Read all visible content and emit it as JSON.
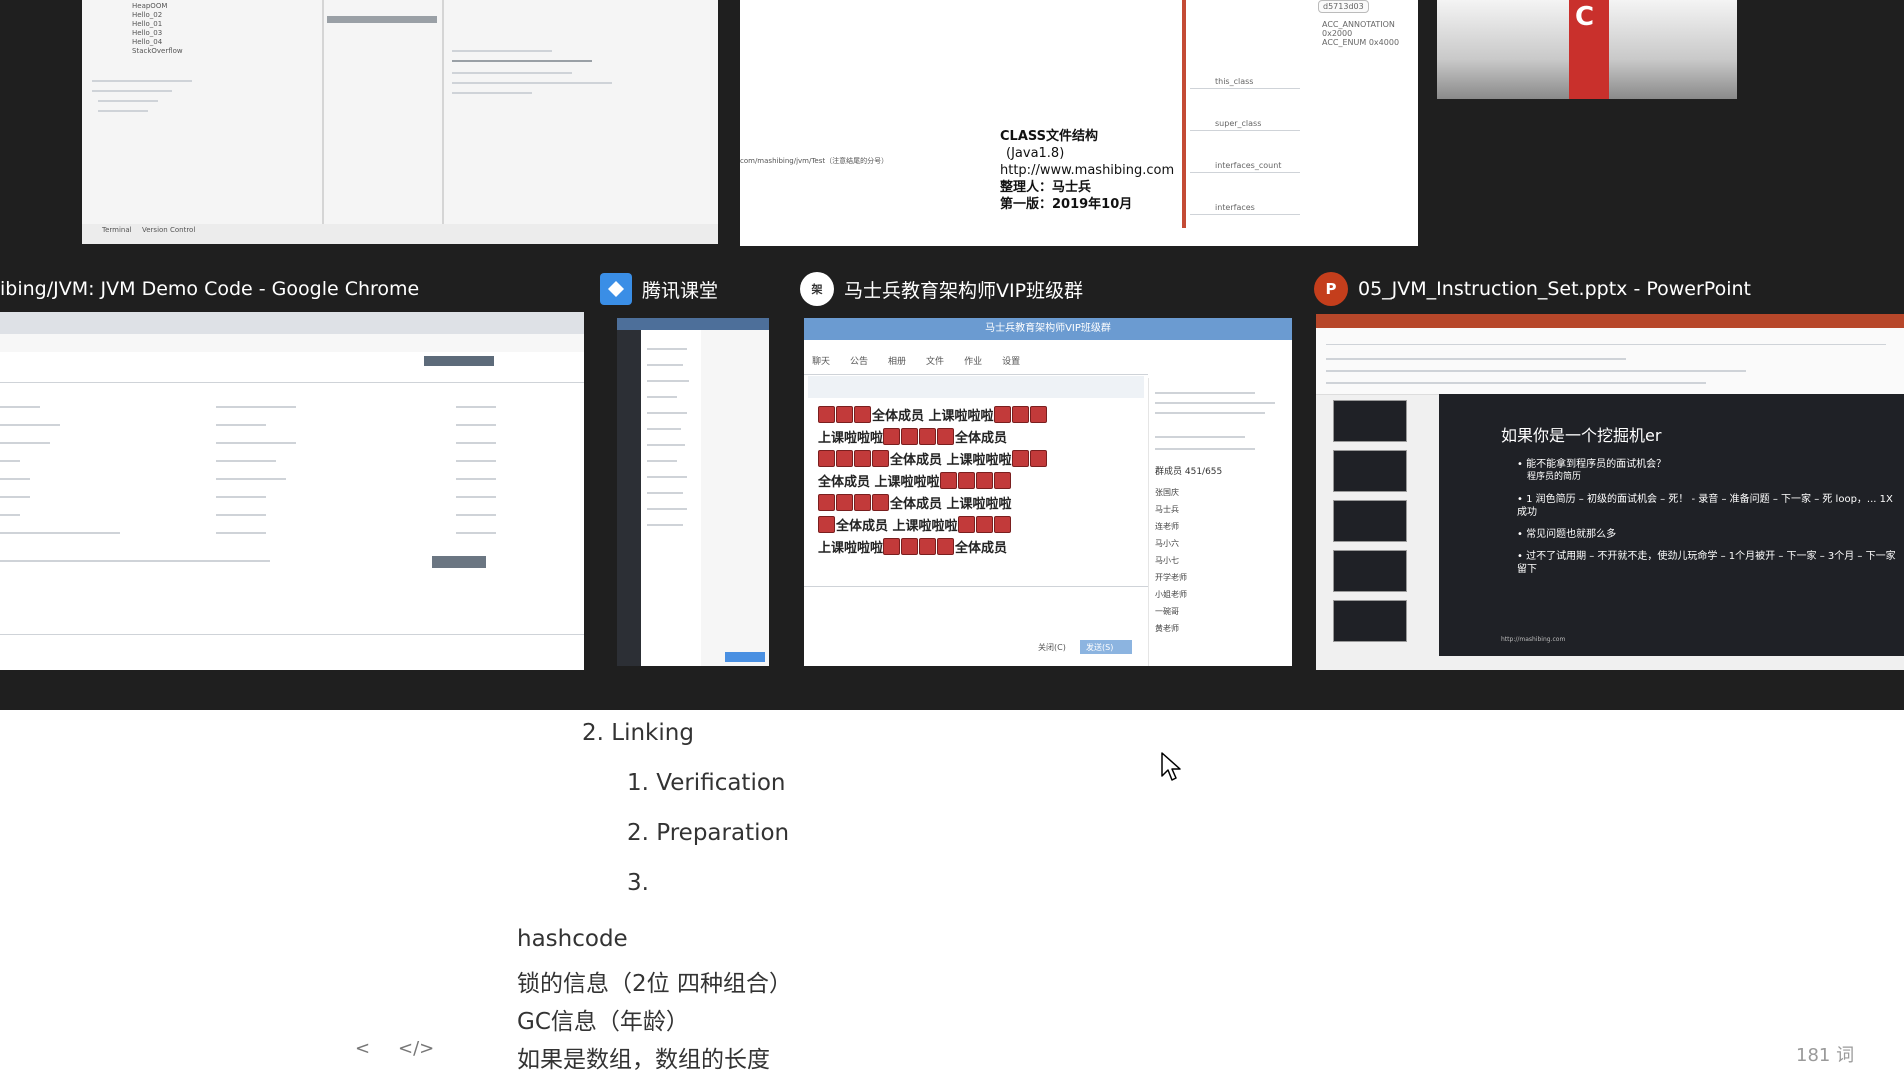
{
  "switcher": {
    "windows": {
      "chrome": {
        "title": "ibing/JVM: JVM Demo Code - Google Chrome"
      },
      "tencent": {
        "title": "腾讯课堂"
      },
      "vip_group": {
        "title": "马士兵教育架构师VIP班级群",
        "chat_title": "马士兵教育架构师VIP班级群",
        "tabs": [
          "聊天",
          "公告",
          "相册",
          "文件",
          "作业",
          "设置"
        ],
        "message_fragments": [
          "全体成员",
          "上课啦啦啦"
        ],
        "member_count": "群成员 451/655",
        "members": [
          "张国庆",
          "马士兵",
          "连老师",
          "马小六",
          "马小七",
          "开学老师",
          "小姐老师",
          "一碗哥",
          "黄老师"
        ],
        "send_label": "发送(S)",
        "close_label": "关闭(C)"
      },
      "powerpoint": {
        "title": "05_JVM_Instruction_Set.pptx - PowerPoint",
        "slide_title": "如果你是一个挖掘机er",
        "bullets": [
          "能不能拿到程序员的面试机会？",
          "程序员的简历",
          "1 润色简历 – 初级的面试机会 – 死！ - 录音 – 准备问题 – 下一家 – 死 loop，... 1X 成功",
          "常见问题也就那么多",
          "过不了试用期 – 不开就不走，使劲儿玩命学 – 1个月被开 – 下一家 – 3个月 – 下一家 留下"
        ],
        "slide_footer": "http://mashibing.com"
      },
      "mindmap": {
        "doc_title": "CLASS文件结构",
        "version": "(Java1.8)",
        "url": "http://www.mashibing.com",
        "author": "整理人：马士兵",
        "edition": "第一版：2019年10月",
        "nodes": [
          "this_class",
          "super_class",
          "interfaces_count",
          "interfaces"
        ],
        "top_nodes": [
          "d5713d03",
          "ACC_ANNOTATION 0x2000",
          "ACC_ENUM 0x4000"
        ],
        "left_note": "com/mashibing/jvm/Test（注意结尾的分号）"
      },
      "ide": {
        "tree_items": [
          "HeapOOM",
          "Hello_02",
          "Hello_01",
          "Hello_03",
          "Hello_04",
          "StackOverflow"
        ],
        "bottom_tabs": [
          "Terminal",
          "Version Control"
        ]
      },
      "red": {
        "letter": "C"
      }
    },
    "icons": {
      "tencent": "tencent-classroom-icon",
      "vip_group": "group-avatar-icon",
      "powerpoint": "powerpoint-icon"
    },
    "colors": {
      "overlay_bg": "#1f1f1f",
      "ppt_accent": "#c43e1c",
      "chat_header": "#6b9bd1"
    }
  },
  "document": {
    "lines": {
      "linking": "2. Linking",
      "verification": "1. Verification",
      "preparation": "2. Preparation",
      "item3": "3.",
      "hashcode": "hashcode",
      "lock_info": "锁的信息（2位 四种组合）",
      "gc_info": "GC信息（年龄）",
      "array_len": "如果是数组，数组的长度"
    },
    "word_count": "181 词",
    "nav": {
      "prev": "<",
      "source": "</>"
    }
  }
}
